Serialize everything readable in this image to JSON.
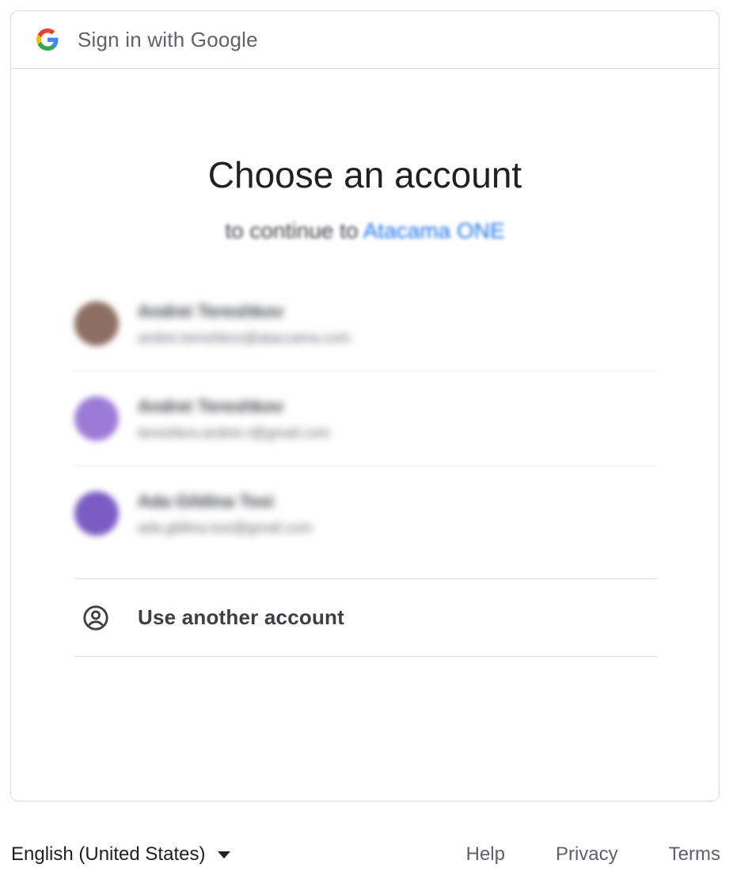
{
  "header": {
    "title": "Sign in with Google",
    "logo_icon": "google-g-icon"
  },
  "main": {
    "title": "Choose an account",
    "subtitle_prefix": "to continue to",
    "app_name": "Atacama ONE",
    "accounts": [
      {
        "name": "Andrei Tereshkov",
        "email": "andrei.tereshkov@ataccama.com",
        "avatar_color": "#8d6e63"
      },
      {
        "name": "Andrei Tereshkov",
        "email": "tereshkov.andrei.r@gmail.com",
        "avatar_color": "#9c7bd6"
      },
      {
        "name": "Ada Gildina Tosi",
        "email": "ada.gildina.tosi@gmail.com",
        "avatar_color": "#7a5cc4"
      }
    ],
    "use_another": {
      "label": "Use another account",
      "icon": "account-circle-icon"
    }
  },
  "footer": {
    "language": "English (United States)",
    "links": {
      "help": "Help",
      "privacy": "Privacy",
      "terms": "Terms"
    }
  },
  "colors": {
    "accent": "#1a73e8",
    "border": "#dadce0",
    "text_secondary": "#5f6368"
  }
}
